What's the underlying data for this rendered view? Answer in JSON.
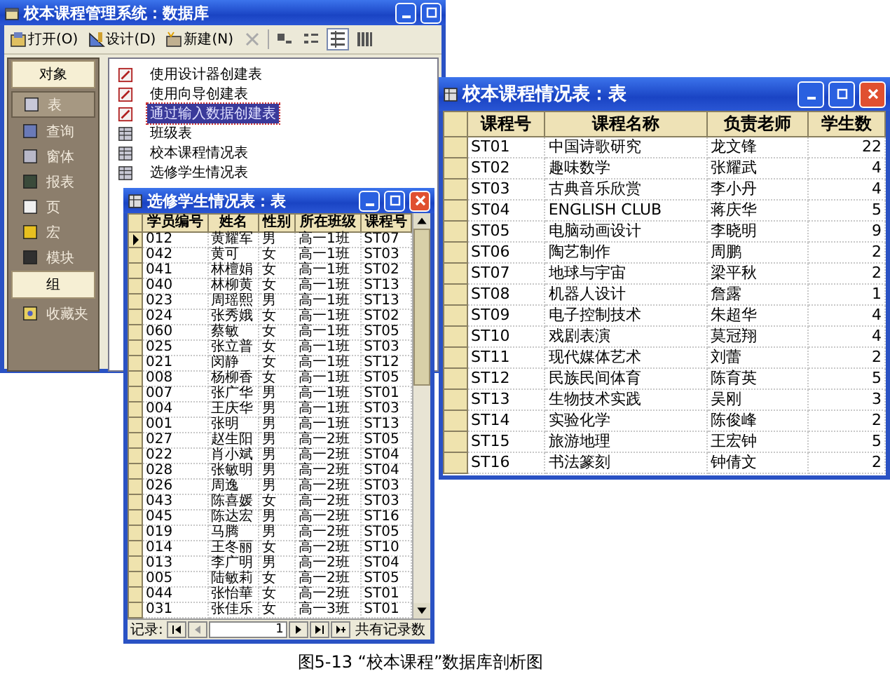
{
  "main_window": {
    "title": "校本课程管理系统：数据库",
    "toolbar": [
      {
        "kind": "open",
        "label": "打开(O)"
      },
      {
        "kind": "design",
        "label": "设计(D)"
      },
      {
        "kind": "new",
        "label": "新建(N)"
      },
      {
        "kind": "delete",
        "disabled": true
      }
    ],
    "views": [
      {
        "kind": "large",
        "selected": false
      },
      {
        "kind": "small",
        "selected": false
      },
      {
        "kind": "list",
        "selected": true
      },
      {
        "kind": "details",
        "selected": false
      }
    ],
    "objects_header": "对象",
    "objects": [
      {
        "kind": "table",
        "label": "表",
        "selected": true
      },
      {
        "kind": "query",
        "label": "查询",
        "selected": false
      },
      {
        "kind": "form",
        "label": "窗体",
        "selected": false
      },
      {
        "kind": "report",
        "label": "报表",
        "selected": false
      },
      {
        "kind": "page",
        "label": "页",
        "selected": false
      },
      {
        "kind": "macro",
        "label": "宏",
        "selected": false
      },
      {
        "kind": "module",
        "label": "模块",
        "selected": false
      }
    ],
    "groups_header": "组",
    "groups": [
      {
        "label": "收藏夹"
      }
    ],
    "list": [
      {
        "kind": "wizard",
        "label": "使用设计器创建表",
        "selected": false
      },
      {
        "kind": "wizard",
        "label": "使用向导创建表",
        "selected": false
      },
      {
        "kind": "wizard",
        "label": "通过输入数据创建表",
        "selected": true
      },
      {
        "kind": "table",
        "label": "班级表",
        "selected": false
      },
      {
        "kind": "table",
        "label": "校本课程情况表",
        "selected": false
      },
      {
        "kind": "table",
        "label": "选修学生情况表",
        "selected": false
      }
    ]
  },
  "student_window": {
    "title": "选修学生情况表：表",
    "columns": [
      "学员编号",
      "姓名",
      "性别",
      "所在班级",
      "课程号"
    ],
    "rows": [
      {
        "current": true,
        "cells": [
          "012",
          "黄耀军",
          "男",
          "高一1班",
          "ST07"
        ]
      },
      {
        "current": false,
        "cells": [
          "042",
          "黄可",
          "女",
          "高一1班",
          "ST03"
        ]
      },
      {
        "current": false,
        "cells": [
          "041",
          "林檀娟",
          "女",
          "高一1班",
          "ST02"
        ]
      },
      {
        "current": false,
        "cells": [
          "040",
          "林柳黄",
          "女",
          "高一1班",
          "ST13"
        ]
      },
      {
        "current": false,
        "cells": [
          "023",
          "周瑶熙",
          "男",
          "高一1班",
          "ST13"
        ]
      },
      {
        "current": false,
        "cells": [
          "024",
          "张秀娥",
          "女",
          "高一1班",
          "ST02"
        ]
      },
      {
        "current": false,
        "cells": [
          "060",
          "蔡敏",
          "女",
          "高一1班",
          "ST05"
        ]
      },
      {
        "current": false,
        "cells": [
          "025",
          "张立普",
          "女",
          "高一1班",
          "ST03"
        ]
      },
      {
        "current": false,
        "cells": [
          "021",
          "闵静",
          "女",
          "高一1班",
          "ST12"
        ]
      },
      {
        "current": false,
        "cells": [
          "008",
          "杨柳香",
          "女",
          "高一1班",
          "ST05"
        ]
      },
      {
        "current": false,
        "cells": [
          "007",
          "张广华",
          "男",
          "高一1班",
          "ST01"
        ]
      },
      {
        "current": false,
        "cells": [
          "004",
          "王庆华",
          "男",
          "高一1班",
          "ST03"
        ]
      },
      {
        "current": false,
        "cells": [
          "001",
          "张明",
          "男",
          "高一1班",
          "ST13"
        ]
      },
      {
        "current": false,
        "cells": [
          "027",
          "赵生阳",
          "男",
          "高一2班",
          "ST05"
        ]
      },
      {
        "current": false,
        "cells": [
          "022",
          "肖小斌",
          "男",
          "高一2班",
          "ST04"
        ]
      },
      {
        "current": false,
        "cells": [
          "028",
          "张敏明",
          "男",
          "高一2班",
          "ST04"
        ]
      },
      {
        "current": false,
        "cells": [
          "026",
          "周逸",
          "男",
          "高一2班",
          "ST03"
        ]
      },
      {
        "current": false,
        "cells": [
          "043",
          "陈喜媛",
          "女",
          "高一2班",
          "ST03"
        ]
      },
      {
        "current": false,
        "cells": [
          "045",
          "陈达宏",
          "男",
          "高一2班",
          "ST16"
        ]
      },
      {
        "current": false,
        "cells": [
          "019",
          "马腾",
          "男",
          "高一2班",
          "ST05"
        ]
      },
      {
        "current": false,
        "cells": [
          "014",
          "王冬丽",
          "女",
          "高一2班",
          "ST10"
        ]
      },
      {
        "current": false,
        "cells": [
          "013",
          "李广明",
          "男",
          "高一2班",
          "ST04"
        ]
      },
      {
        "current": false,
        "cells": [
          "005",
          "陆敏莉",
          "女",
          "高一2班",
          "ST05"
        ]
      },
      {
        "current": false,
        "cells": [
          "044",
          "张怡華",
          "女",
          "高一2班",
          "ST01"
        ]
      },
      {
        "current": false,
        "cells": [
          "031",
          "张佳乐",
          "女",
          "高一3班",
          "ST01"
        ]
      }
    ],
    "nav": {
      "label": "记录:",
      "record": "1",
      "total_label": "共有记录数"
    }
  },
  "course_window": {
    "title": "校本课程情况表：表",
    "columns": [
      "课程号",
      "课程名称",
      "负责老师",
      "学生数"
    ],
    "rows": [
      [
        "ST01",
        "中国诗歌研究",
        "龙文锋",
        "22"
      ],
      [
        "ST02",
        "趣味数学",
        "张耀武",
        "4"
      ],
      [
        "ST03",
        "古典音乐欣赏",
        "李小丹",
        "4"
      ],
      [
        "ST04",
        "ENGLISH CLUB",
        "蒋庆华",
        "5"
      ],
      [
        "ST05",
        "电脑动画设计",
        "李晓明",
        "9"
      ],
      [
        "ST06",
        "陶艺制作",
        "周鹏",
        "2"
      ],
      [
        "ST07",
        "地球与宇宙",
        "梁平秋",
        "2"
      ],
      [
        "ST08",
        "机器人设计",
        "詹露",
        "1"
      ],
      [
        "ST09",
        "电子控制技术",
        "朱超华",
        "4"
      ],
      [
        "ST10",
        "戏剧表演",
        "莫冠翔",
        "4"
      ],
      [
        "ST11",
        "现代媒体艺术",
        "刘蕾",
        "2"
      ],
      [
        "ST12",
        "民族民间体育",
        "陈育英",
        "5"
      ],
      [
        "ST13",
        "生物技术实践",
        "吴刚",
        "3"
      ],
      [
        "ST14",
        "实验化学",
        "陈俊峰",
        "2"
      ],
      [
        "ST15",
        "旅游地理",
        "王宏钟",
        "5"
      ],
      [
        "ST16",
        "书法篆刻",
        "钟倩文",
        "2"
      ]
    ]
  },
  "caption": "图5-13 “校本课程”数据库剖析图"
}
